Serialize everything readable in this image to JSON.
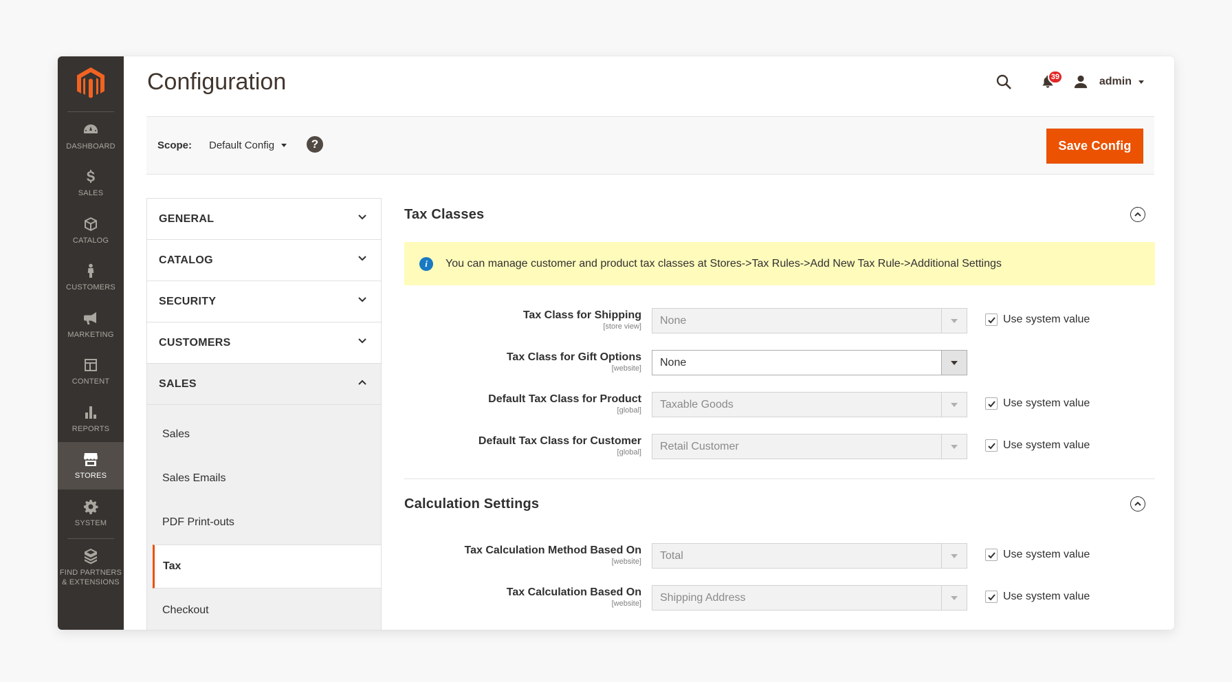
{
  "sidebar": {
    "items": [
      {
        "label": "DASHBOARD",
        "icon": "dashboard-icon"
      },
      {
        "label": "SALES",
        "icon": "dollar-icon"
      },
      {
        "label": "CATALOG",
        "icon": "box-icon"
      },
      {
        "label": "CUSTOMERS",
        "icon": "person-icon"
      },
      {
        "label": "MARKETING",
        "icon": "megaphone-icon"
      },
      {
        "label": "CONTENT",
        "icon": "layout-icon"
      },
      {
        "label": "REPORTS",
        "icon": "bar-chart-icon"
      },
      {
        "label": "STORES",
        "icon": "store-icon",
        "active": true
      },
      {
        "label": "SYSTEM",
        "icon": "gear-icon"
      },
      {
        "label": "FIND PARTNERS\n& EXTENSIONS",
        "line1": "FIND PARTNERS",
        "line2": "& EXTENSIONS",
        "icon": "extensions-icon"
      }
    ]
  },
  "header": {
    "title": "Configuration",
    "notification_count": "39",
    "user_name": "admin"
  },
  "scope": {
    "label": "Scope:",
    "value": "Default Config",
    "save_label": "Save Config"
  },
  "tabs": {
    "general": "GENERAL",
    "catalog": "CATALOG",
    "security": "SECURITY",
    "customers": "CUSTOMERS",
    "sales": "SALES",
    "sales_items": [
      "Sales",
      "Sales Emails",
      "PDF Print-outs",
      "Tax",
      "Checkout"
    ]
  },
  "tax_classes": {
    "title": "Tax Classes",
    "notice": "You can manage customer and product tax classes at Stores->Tax Rules->Add New Tax Rule->Additional Settings",
    "fields": [
      {
        "label": "Tax Class for Shipping",
        "scope": "[store view]",
        "value": "None",
        "use_system": true
      },
      {
        "label": "Tax Class for Gift Options",
        "scope": "[website]",
        "value": "None",
        "use_system": false
      },
      {
        "label": "Default Tax Class for Product",
        "scope": "[global]",
        "value": "Taxable Goods",
        "use_system": true
      },
      {
        "label": "Default Tax Class for Customer",
        "scope": "[global]",
        "value": "Retail Customer",
        "use_system": true
      }
    ]
  },
  "calculation_settings": {
    "title": "Calculation Settings",
    "fields": [
      {
        "label": "Tax Calculation Method Based On",
        "scope": "[website]",
        "value": "Total",
        "use_system": true
      },
      {
        "label": "Tax Calculation Based On",
        "scope": "[website]",
        "value": "Shipping Address",
        "use_system": true
      }
    ]
  },
  "use_system_label": "Use system value",
  "colors": {
    "accent": "#eb5202",
    "sidebar_bg": "#373330",
    "sidebar_active": "#524d49",
    "notice_bg": "#fffbbb",
    "badge": "#e22626"
  }
}
